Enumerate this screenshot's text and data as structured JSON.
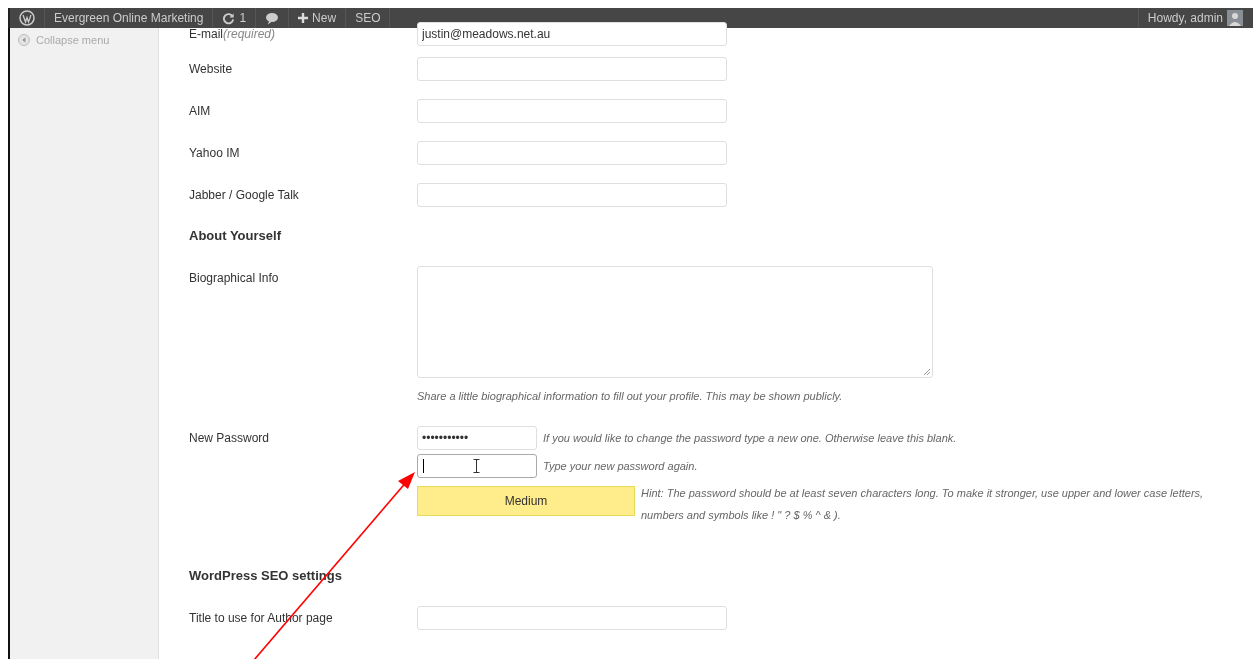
{
  "admin_bar": {
    "site_name": "Evergreen Online Marketing",
    "updates_count": "1",
    "new_label": "New",
    "seo_label": "SEO",
    "greeting": "Howdy, admin"
  },
  "sidebar": {
    "collapse_label": "Collapse menu"
  },
  "contact_fields": [
    {
      "label": "E-mail",
      "note": "(required)",
      "value": "justin@meadows.net.au"
    },
    {
      "label": "Website"
    },
    {
      "label": "AIM"
    },
    {
      "label": "Yahoo IM"
    },
    {
      "label": "Jabber / Google Talk"
    }
  ],
  "about": {
    "heading": "About Yourself",
    "bio_label": "Biographical Info",
    "bio_description": "Share a little biographical information to fill out your profile. This may be shown publicly."
  },
  "password": {
    "label": "New Password",
    "value": "•••••••••••",
    "description": "If you would like to change the password type a new one. Otherwise leave this blank.",
    "repeat_description": "Type your new password again.",
    "strength": "Medium",
    "hint": "Hint: The password should be at least seven characters long. To make it stronger, use upper and lower case letters, numbers and symbols like ! \" ? $ % ^ & )."
  },
  "seo": {
    "heading": "WordPress SEO settings",
    "fields": [
      {
        "label": "Title to use for Author page"
      }
    ]
  }
}
